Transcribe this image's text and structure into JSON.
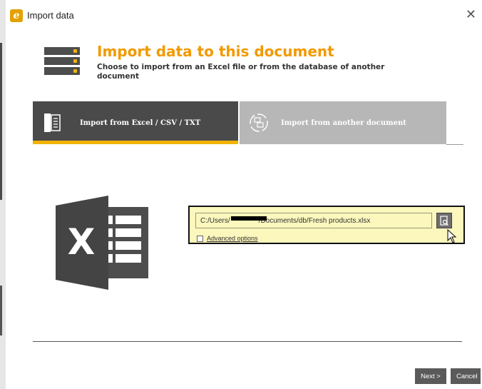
{
  "window": {
    "title": "Import data",
    "app_icon_letter": "e"
  },
  "header": {
    "title": "Import data to this document",
    "subtitle": "Choose to import from an Excel file or from the database of another document"
  },
  "tabs": [
    {
      "label": "Import from Excel / CSV / TXT",
      "active": true
    },
    {
      "label": "Import from another document",
      "active": false
    }
  ],
  "file": {
    "path_value": "C:/Users/    /Documents/db/Fresh products.xlsx",
    "advanced_options_label": "Advanced options",
    "advanced_options_checked": false
  },
  "footer": {
    "next_label": "Next >",
    "cancel_label": "Cancel"
  },
  "colors": {
    "accent": "#f29900",
    "tab_active": "#4a4a4a",
    "tab_inactive": "#b7b7b7",
    "underline": "#f0b400",
    "panel": "#fbf7bd"
  }
}
